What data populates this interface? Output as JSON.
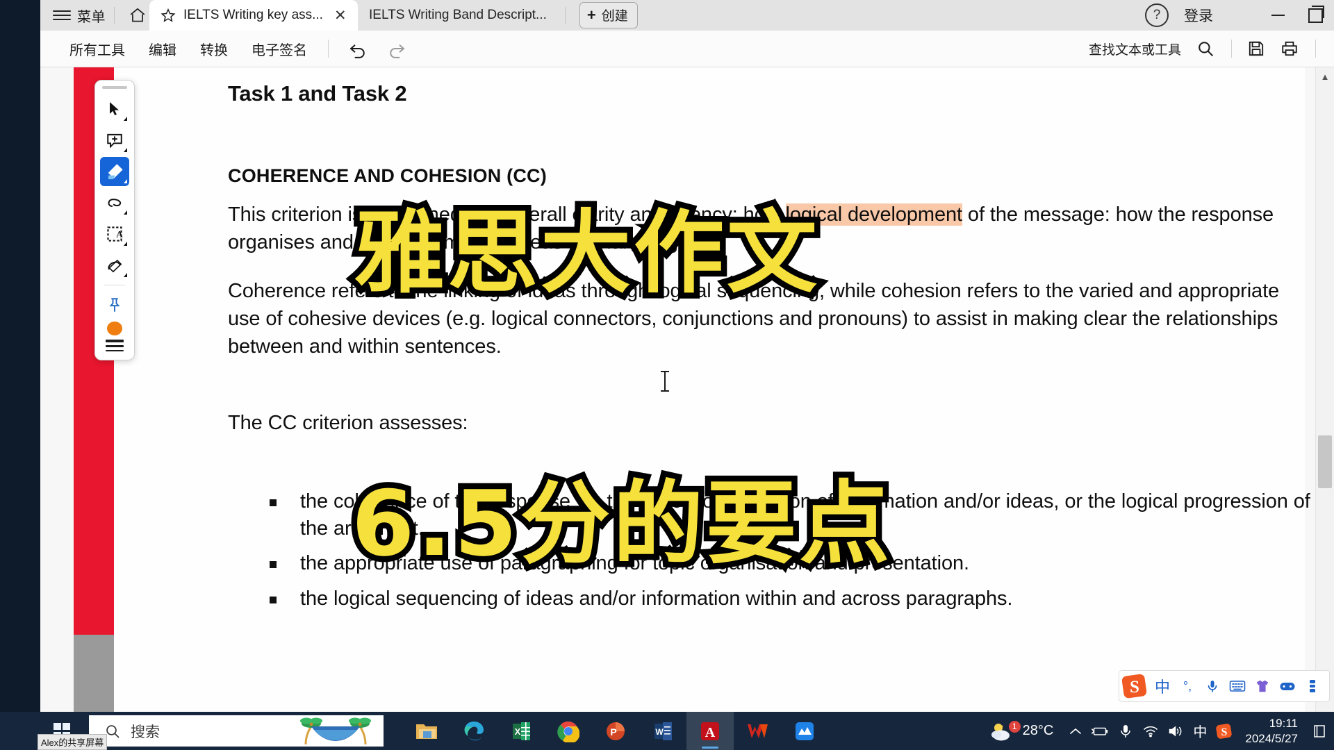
{
  "titlebar": {
    "menu_label": "菜单",
    "home_icon": "home-icon",
    "tabs": [
      {
        "label": "IELTS Writing key ass...",
        "active": true,
        "close": "✕",
        "star": "star-icon"
      },
      {
        "label": "IELTS Writing Band Descript...",
        "active": false
      }
    ],
    "create_button": {
      "plus": "+",
      "label": "创建"
    },
    "help_icon_char": "?",
    "login_label": "登录",
    "minimize": "minimize-icon",
    "restore": "restore-icon"
  },
  "toolbar": {
    "items": [
      "所有工具",
      "编辑",
      "转换",
      "电子签名"
    ],
    "undo_icon": "undo-icon",
    "redo_icon": "redo-icon",
    "find_label": "查找文本或工具",
    "search_icon": "search-icon",
    "save_icon": "save-icon",
    "print_icon": "print-icon"
  },
  "annotation_palette": {
    "tools": [
      {
        "name": "select-tool",
        "icon": "cursor-arrow-icon",
        "selected": false
      },
      {
        "name": "add-comment-tool",
        "icon": "comment-plus-icon",
        "selected": false
      },
      {
        "name": "highlight-tool",
        "icon": "highlighter-icon",
        "selected": true
      },
      {
        "name": "draw-free-tool",
        "icon": "lasso-loop-icon",
        "selected": false
      },
      {
        "name": "text-box-tool",
        "icon": "dashed-box-a-icon",
        "selected": false
      },
      {
        "name": "erase-tool",
        "icon": "eraser-pen-icon",
        "selected": false
      },
      {
        "name": "pin-tool",
        "icon": "pushpin-icon",
        "selected": false
      }
    ],
    "color_swatch": "#ef7d10",
    "thickness_icon": "line-thickness-icon"
  },
  "document": {
    "heading_task": "Task 1 and Task 2",
    "heading_criterion": "COHERENCE AND COHESION (CC)",
    "paragraph_1_pre": "This criterion is concerned with overall clarity and fluency: how ",
    "paragraph_1_highlight": "logical development",
    "paragraph_1_post": " of the message: how the response organises and links information, ideas and language.",
    "paragraph_2": "Coherence refers to the linking of ideas through logical sequencing, while cohesion refers to the varied and appropriate use of cohesive devices (e.g. logical connectors, conjunctions and pronouns) to assist in making clear the relationships between and within sentences.",
    "paragraph_3": "The CC criterion assesses:",
    "bullets": [
      "the coherence of the response via the logical organisation of information and/or ideas, or the logical progression of the argument.",
      "the appropriate use of paragraphing for topic organisation and presentation.",
      "the logical sequencing of ideas and/or information within and across paragraphs."
    ],
    "highlight_color": "#f9c8a8"
  },
  "overlay_captions": {
    "line1": "雅思大作文",
    "line2": "6.5分的要点",
    "fill_color": "#f5e03c",
    "stroke_color": "#000000"
  },
  "scrollbar": {
    "up_arrow": "▲"
  },
  "ime_bar": {
    "logo": "sogou-logo-icon",
    "items": [
      "中",
      "°,",
      "mic-icon",
      "keyboard-icon",
      "skin-shirt-icon",
      "game-controller-icon",
      "menu-dots-icon"
    ]
  },
  "taskbar": {
    "start_icon": "windows-logo-icon",
    "share_tooltip": "Alex的共享屏幕",
    "search_placeholder": "搜索",
    "search_icon": "search-icon",
    "apps": [
      {
        "name": "file-explorer",
        "active": false
      },
      {
        "name": "microsoft-edge",
        "active": false
      },
      {
        "name": "microsoft-excel",
        "active": false
      },
      {
        "name": "google-chrome",
        "active": false
      },
      {
        "name": "microsoft-powerpoint",
        "active": false
      },
      {
        "name": "microsoft-word",
        "active": false
      },
      {
        "name": "adobe-acrobat",
        "active": true
      },
      {
        "name": "wps-office",
        "active": false
      },
      {
        "name": "blue-app",
        "active": false
      }
    ],
    "weather": {
      "temperature": "28°C",
      "badge": "1",
      "icon": "sun-cloud-icon"
    },
    "tray_icons": [
      "chevron-up-icon",
      "battery-icon",
      "microphone-icon",
      "wifi-icon",
      "volume-icon"
    ],
    "ime_indicator": "中",
    "sogou_icon": "sogou-logo-icon",
    "time": "19:11",
    "date": "2024/5/27",
    "notification_icon": "notification-icon"
  }
}
